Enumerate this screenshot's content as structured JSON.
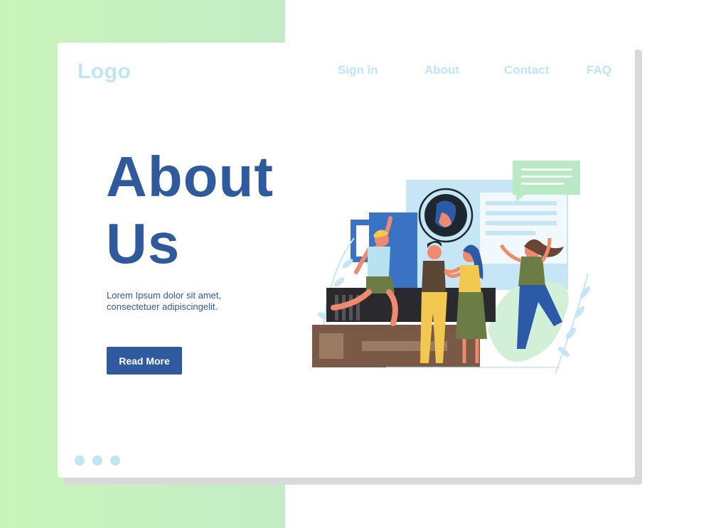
{
  "header": {
    "logo": "Logo",
    "nav": [
      {
        "label": "Sign in"
      },
      {
        "label": "About"
      },
      {
        "label": "Contact"
      },
      {
        "label": "FAQ"
      }
    ]
  },
  "hero": {
    "title": "About Us",
    "body": "Lorem Ipsum dolor sit amet, consectetuer adipiscingelit.",
    "cta_label": "Read More"
  },
  "pagination": {
    "dot_count": 3
  },
  "colors": {
    "brand_blue": "#2f5a9d",
    "light_blue": "#bfe6f3",
    "green_bg": "#c9f4b9",
    "shadow": "#d9d9d9"
  },
  "illustration": {
    "name": "team-celebration-illustration"
  }
}
